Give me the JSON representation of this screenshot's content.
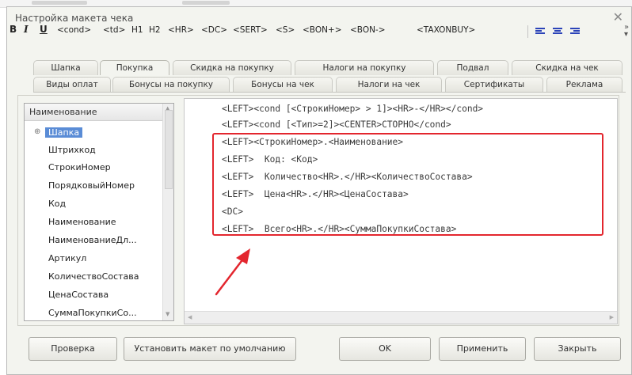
{
  "window": {
    "title": "Настройка макета чека"
  },
  "toolbar": {
    "items": [
      "B",
      "I",
      "U",
      "<cond>",
      "<td>",
      "H1",
      "H2",
      "<HR>",
      "<DC>",
      "<SERT>",
      "<S>",
      "<BON+>",
      "<BON->",
      "<TAXONBUY>"
    ],
    "align_icons": [
      "align-left-icon",
      "align-center-icon",
      "align-right-icon"
    ],
    "more": "»"
  },
  "tabs_row1": [
    "Шапка",
    "Покупка",
    "Скидка на покупку",
    "Налоги на покупку",
    "Подвал",
    "Скидка на чек"
  ],
  "tabs_row2": [
    "Виды оплат",
    "Бонусы на покупку",
    "Бонусы на чек",
    "Налоги на чек",
    "Сертификаты",
    "Реклама"
  ],
  "active_tab": "Покупка",
  "tree": {
    "header": "Наименование",
    "expand_glyph": "⊕",
    "items": [
      "Шапка",
      "Штрихкод",
      "СтрокиНомер",
      "ПорядковыйНомер",
      "Код",
      "Наименование",
      "НаименованиеДл...",
      "Артикул",
      "КоличествоСостава",
      "ЦенаСостава",
      "СуммаПокупкиСо..."
    ]
  },
  "editor": {
    "lines": [
      "<LEFT><cond [<СтрокиНомер> > 1]><HR>-</HR></cond>",
      "<LEFT><cond [<Тип>=2]><CENTER>СТОРНО</cond>",
      "<LEFT><СтрокиНомер>.<Наименование>",
      "<LEFT>  Код: <Код>",
      "<LEFT>  Количество<HR>.</HR><КоличествоСостава>",
      "<LEFT>  Цена<HR>.</HR><ЦенаСостава>",
      "<DC>",
      "<LEFT>  Всего<HR>.</HR><СуммаПокупкиСостава>"
    ]
  },
  "buttons": {
    "check": "Проверка",
    "default": "Установить макет по умолчанию",
    "ok": "OK",
    "apply": "Применить",
    "close": "Закрыть"
  },
  "colors": {
    "highlight": "#e3262e",
    "selection": "#5a8cd6",
    "align_icon": "#2b43b8"
  }
}
